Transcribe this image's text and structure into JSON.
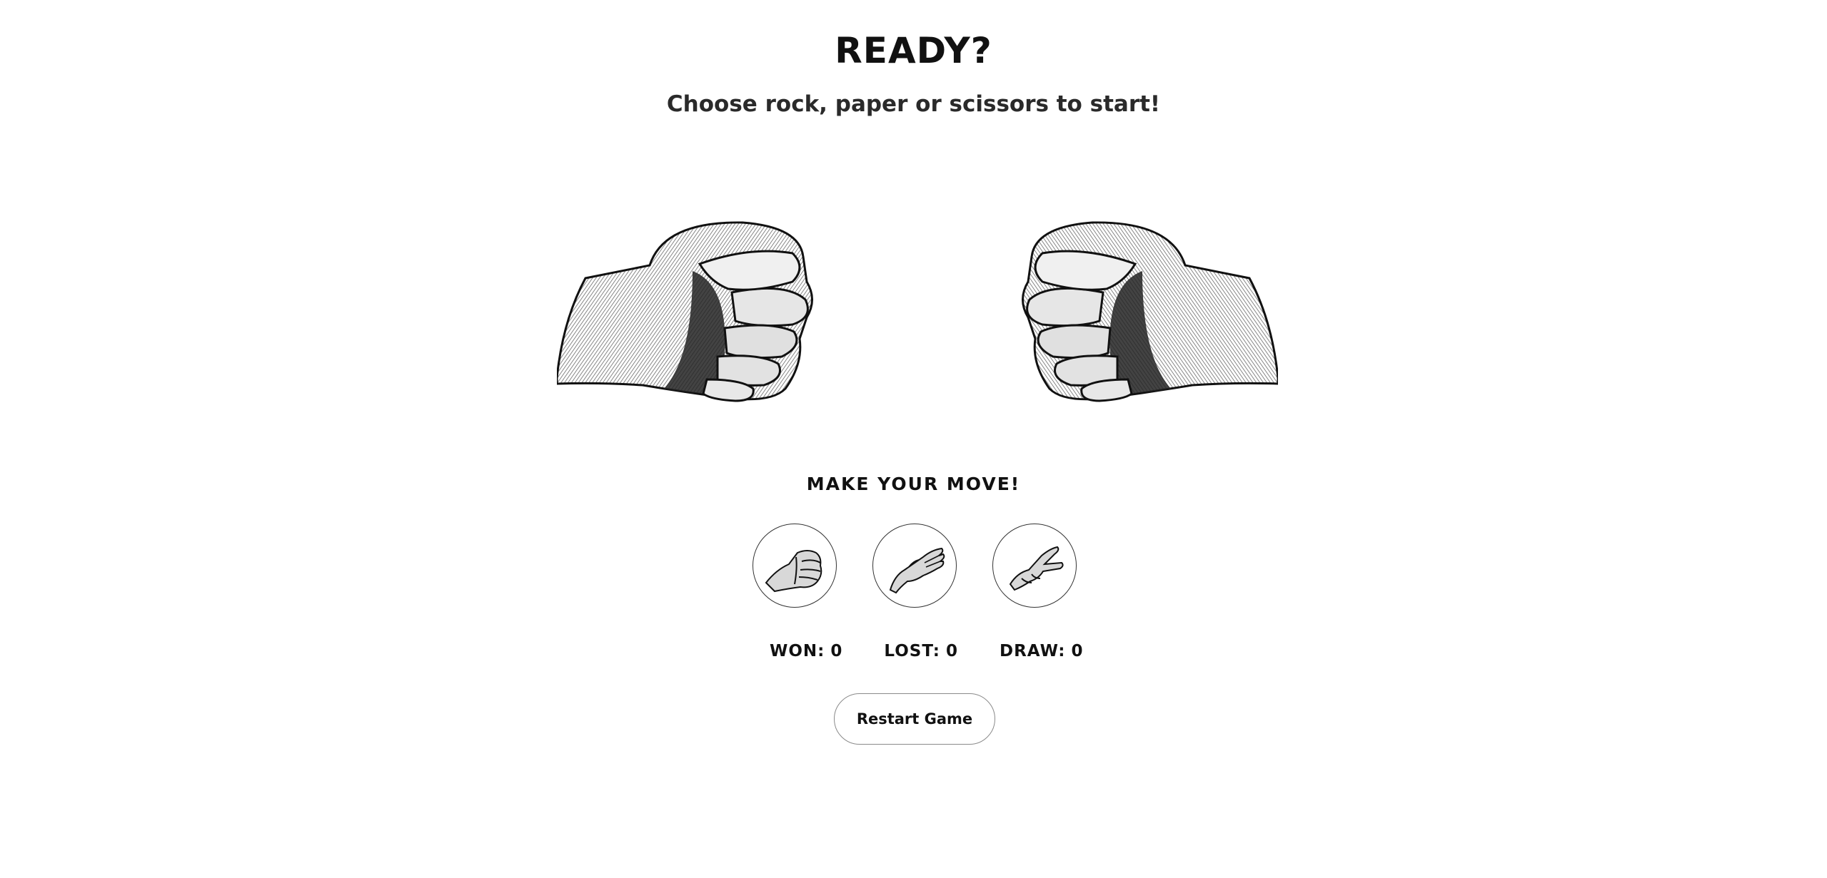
{
  "header": {
    "title": "READY?",
    "subtitle": "Choose rock, paper or scissors to start!"
  },
  "arena": {
    "player_hand": "rock-fist-icon",
    "computer_hand": "rock-fist-icon"
  },
  "controls": {
    "prompt": "MAKE YOUR MOVE!",
    "choices": [
      {
        "icon": "rock-icon"
      },
      {
        "icon": "paper-icon"
      },
      {
        "icon": "scissors-icon"
      }
    ]
  },
  "scoreboard": {
    "won_label": "WON:",
    "won_value": "0",
    "lost_label": "LOST:",
    "lost_value": "0",
    "draw_label": "DRAW:",
    "draw_value": "0"
  },
  "restart_label": "Restart Game"
}
